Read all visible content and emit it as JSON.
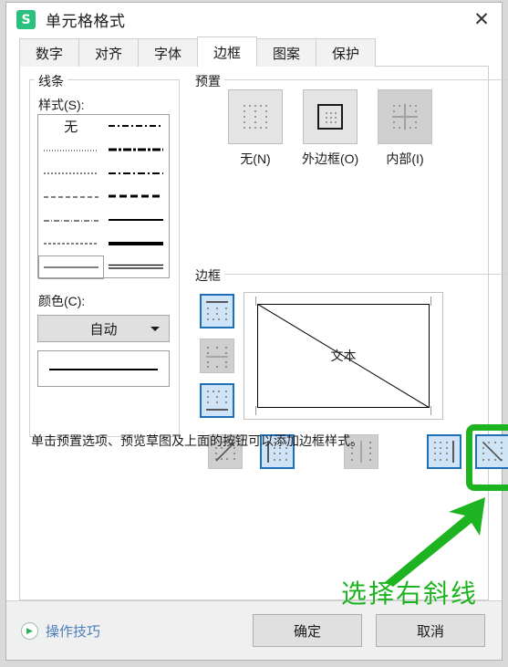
{
  "window": {
    "title": "单元格格式",
    "logo_letter": "S",
    "logo_color": "#2cc07e",
    "close_icon": "✕"
  },
  "tabs": [
    {
      "label": "数字",
      "active": false
    },
    {
      "label": "对齐",
      "active": false
    },
    {
      "label": "字体",
      "active": false
    },
    {
      "label": "边框",
      "active": true
    },
    {
      "label": "图案",
      "active": false
    },
    {
      "label": "保护",
      "active": false
    }
  ],
  "line_group": {
    "title": "线条",
    "style_label": "样式(S):",
    "none_label": "无",
    "color_label": "颜色(C):",
    "color_value": "自动"
  },
  "preset_group": {
    "title": "预置",
    "items": [
      {
        "label": "无(N)",
        "icon": "dotted-grid-icon",
        "state": "enabled"
      },
      {
        "label": "外边框(O)",
        "icon": "outline-box-icon",
        "state": "enabled"
      },
      {
        "label": "内部(I)",
        "icon": "inner-cross-icon",
        "state": "disabled"
      }
    ]
  },
  "border_group": {
    "title": "边框",
    "preview_text": "文本",
    "side_buttons": [
      {
        "name": "border-top-button",
        "icon": "border-top-icon",
        "state": "selected"
      },
      {
        "name": "border-horizontal-button",
        "icon": "border-horizontal-icon",
        "state": "disabled"
      },
      {
        "name": "border-bottom-button",
        "icon": "border-bottom-icon",
        "state": "selected"
      }
    ],
    "bottom_buttons": [
      {
        "name": "border-diagonal-up-button",
        "icon": "diagonal-up-icon",
        "state": "disabled"
      },
      {
        "name": "border-left-button",
        "icon": "border-left-icon",
        "state": "selected"
      },
      {
        "name": "border-vertical-button",
        "icon": "border-vertical-icon",
        "state": "disabled"
      },
      {
        "name": "border-right-button",
        "icon": "border-right-icon",
        "state": "selected"
      },
      {
        "name": "border-diagonal-down-button",
        "icon": "diagonal-down-icon",
        "state": "selected"
      }
    ]
  },
  "hint": "单击预置选项、预览草图及上面的按钮可以添加边框样式。",
  "annotation": {
    "text": "选择右斜线",
    "color": "#1eb421"
  },
  "footer": {
    "tips_label": "操作技巧",
    "tips_icon": "play-circle-icon",
    "ok_label": "确定",
    "cancel_label": "取消"
  }
}
